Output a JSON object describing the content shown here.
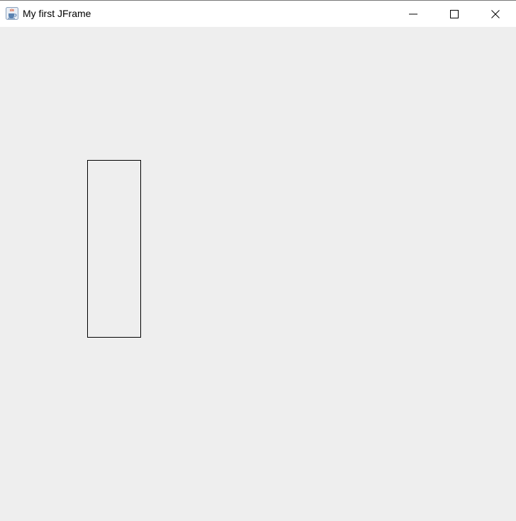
{
  "window": {
    "title": "My first JFrame",
    "app_icon": "java-coffee-cup-icon",
    "controls": {
      "minimize_icon": "minimize-icon",
      "maximize_icon": "maximize-icon",
      "close_icon": "close-icon"
    }
  },
  "content": {
    "background_color": "#eeeeee",
    "shapes": [
      {
        "kind": "rectangle-outline",
        "stroke_color": "#000000"
      }
    ]
  }
}
